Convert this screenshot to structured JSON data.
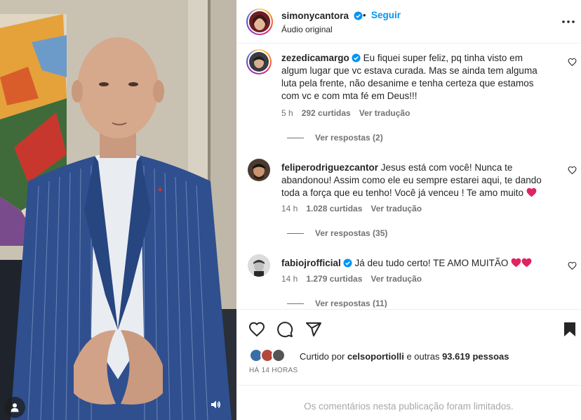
{
  "header": {
    "username": "simonycantora",
    "bullet": "•",
    "follow_label": "Seguir",
    "audio_label": "Áudio original",
    "more_icon": "more-horizontal-icon"
  },
  "comments": [
    {
      "username": "zezedicamargo",
      "verified": true,
      "text": "Eu fiquei super feliz, pq tinha visto em algum lugar que vc estava curada. Mas se ainda tem alguma luta pela frente, não desanime e tenha certeza que estamos com vc e com mta fé em Deus!!!",
      "time": "5 h",
      "likes": "292 curtidas",
      "reply_label": "Ver tradução",
      "view_replies": "Ver respostas (2)"
    },
    {
      "username": "feliperodriguezcantor",
      "verified": false,
      "text": "Jesus está com você! Nunca te abandonou! Assim como ele eu sempre estarei aqui, te dando toda a força que eu tenho! Você já venceu ! Te amo muito",
      "time": "14 h",
      "likes": "1.028 curtidas",
      "reply_label": "Ver tradução",
      "view_replies": "Ver respostas (35)"
    },
    {
      "username": "fabiojrofficial",
      "verified": true,
      "text": "Já deu tudo certo! TE AMO MUITÃO",
      "time": "14 h",
      "likes": "1.279 curtidas",
      "reply_label": "Ver tradução",
      "view_replies": "Ver respostas (11)"
    }
  ],
  "actions": {
    "like_icon": "heart-outline-icon",
    "comment_icon": "comment-bubble-icon",
    "share_icon": "paper-plane-icon",
    "save_icon": "bookmark-filled-icon"
  },
  "likes": {
    "prefix": "Curtido por",
    "user": "celsoportiolli",
    "suffix": "e outras",
    "count": "93.619 pessoas"
  },
  "post_time": "HÁ 14 HORAS",
  "footer_message": "Os comentários nesta publicação foram limitados.",
  "colors": {
    "accent": "#0095f6",
    "verified": "#0095f6",
    "secondary_text": "#737373",
    "emoji_heart": "#e0245e"
  }
}
